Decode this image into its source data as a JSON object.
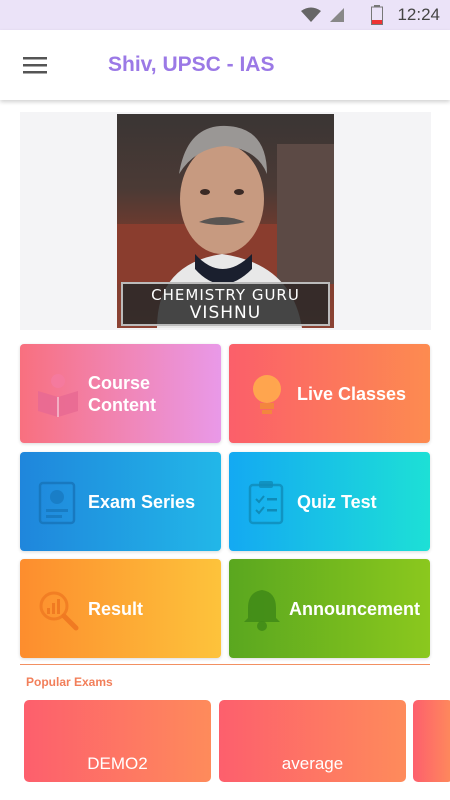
{
  "status_bar": {
    "time": "12:24"
  },
  "app_bar": {
    "title": "Shiv, UPSC - IAS"
  },
  "banner": {
    "caption_line1": "CHEMISTRY GURU",
    "caption_line2": "VISHNU"
  },
  "tiles": [
    {
      "label": "Course Content",
      "icon": "reading-book-icon"
    },
    {
      "label": "Live Classes",
      "icon": "light-bulb-icon"
    },
    {
      "label": "Exam Series",
      "icon": "exam-document-icon"
    },
    {
      "label": "Quiz Test",
      "icon": "clipboard-checklist-icon"
    },
    {
      "label": "Result",
      "icon": "chart-magnifier-icon"
    },
    {
      "label": "Announcement",
      "icon": "bell-icon"
    }
  ],
  "popular": {
    "title": "Popular Exams",
    "items": [
      {
        "label": "DEMO2"
      },
      {
        "label": "average"
      },
      {
        "label": ""
      }
    ]
  },
  "colors": {
    "accent": "#9b79e6",
    "section": "#f27f5a"
  }
}
